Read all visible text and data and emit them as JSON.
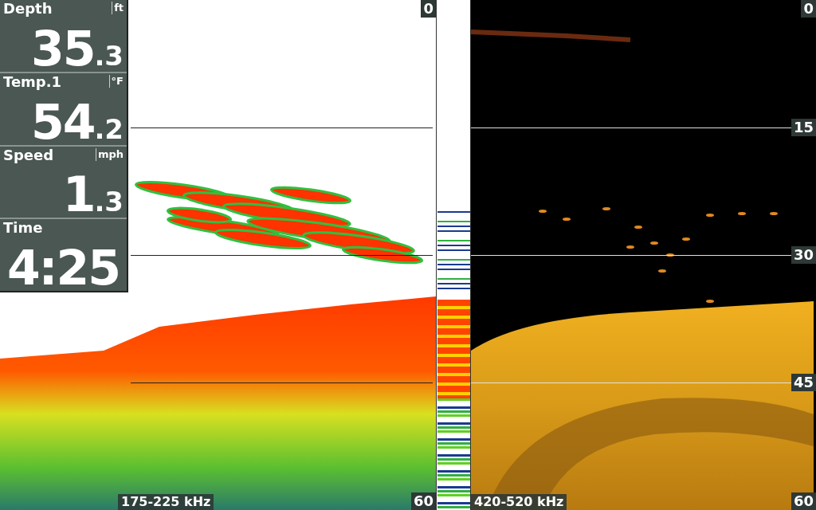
{
  "readouts": [
    {
      "label": "Depth",
      "unit": "ft",
      "whole": "35",
      "fraction": ".3"
    },
    {
      "label": "Temp.1",
      "unit": "°F",
      "whole": "54",
      "fraction": ".2"
    },
    {
      "label": "Speed",
      "unit": "mph",
      "whole": "1",
      "fraction": ".3"
    },
    {
      "label": "Time",
      "whole": "4:25"
    }
  ],
  "panels": [
    {
      "kind": "down",
      "frequency": "175-225 kHz",
      "depth_labels": [
        "0",
        "60"
      ]
    },
    {
      "kind": "side",
      "frequency": "420-520 kHz",
      "depth_labels": [
        "0",
        "15",
        "30",
        "45",
        "60"
      ]
    }
  ]
}
